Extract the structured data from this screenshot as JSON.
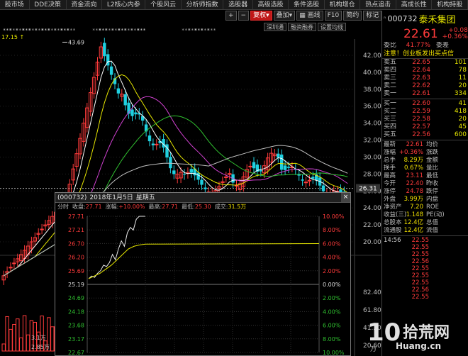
{
  "menu": [
    "股市场",
    "DDE决策",
    "资金流向",
    "L2核心内参",
    "个股风云",
    "分析师指数",
    "选股器",
    "高级选股",
    "条件选股",
    "机构增仓",
    "热点追击",
    "高成长性",
    "机构持股"
  ],
  "toolbar": {
    "plus": "+",
    "minus": "−",
    "restore": "复权",
    "overlay": "叠加",
    "lines": "画线",
    "f10": "F10",
    "flip": "简约",
    "marker": "标记"
  },
  "toolbar2": [
    "深圳通",
    "融资融券",
    "设置均线"
  ],
  "main": {
    "top_price_label": "17.15",
    "peak_label": "43.69",
    "axis_ticks": [
      "42.00",
      "40.00",
      "38.00",
      "36.00",
      "34.00",
      "32.00",
      "30.00",
      "28.00",
      "26.00",
      "24.00",
      "22.00",
      "20.00"
    ],
    "current_price_tag": "26.31",
    "vol_ticks": [
      "82.40",
      "61.80",
      "41.20",
      "20.60"
    ],
    "vol_unit": "万",
    "vol_left": [
      "3.1万",
      "2.85万"
    ]
  },
  "popup": {
    "title_code": "(000732)",
    "title_date": "2018年1月5日",
    "title_weekday": "星期五",
    "close": "×",
    "info": {
      "tab": "分时",
      "close_label": "收盘:",
      "close_value": "27.71",
      "chg_label": "涨幅:",
      "chg_value": "+10.00%",
      "high_label": "最高:",
      "high_value": "27.71",
      "low_label": "最低:",
      "low_value": "25.30",
      "amt_label": "成交:",
      "amt_value": "31.5万"
    },
    "left_ticks": [
      "27.71",
      "27.21",
      "26.70",
      "26.20",
      "25.69",
      "25.19",
      "24.69",
      "24.18",
      "23.68",
      "23.17",
      "22.67"
    ],
    "right_ticks": [
      "10.00%",
      "8.00%",
      "6.00%",
      "4.00%",
      "2.00%",
      "0.00%",
      "2.00%",
      "4.00%",
      "6.00%",
      "8.00%",
      "10.00%"
    ]
  },
  "stock": {
    "code": "000732",
    "name": "泰禾集团",
    "price": "22.61",
    "change": "+0.08",
    "change_pct": "+0.36%"
  },
  "ratio": {
    "k1": "委比",
    "v1": "41.77%",
    "k2": "委差",
    "v2": ""
  },
  "notice": "注意！创业板发出买点信",
  "sells": [
    {
      "k": "卖五",
      "v": "22.65",
      "q": "101"
    },
    {
      "k": "卖四",
      "v": "22.64",
      "q": "78"
    },
    {
      "k": "卖三",
      "v": "22.63",
      "q": "11"
    },
    {
      "k": "卖二",
      "v": "22.62",
      "q": "20"
    },
    {
      "k": "卖一",
      "v": "22.61",
      "q": "334"
    }
  ],
  "buys": [
    {
      "k": "买一",
      "v": "22.60",
      "q": "41"
    },
    {
      "k": "买二",
      "v": "22.59",
      "q": "418"
    },
    {
      "k": "买三",
      "v": "22.58",
      "q": "20"
    },
    {
      "k": "买四",
      "v": "22.57",
      "q": "45"
    },
    {
      "k": "买五",
      "v": "22.56",
      "q": "600"
    }
  ],
  "stats": [
    {
      "k1": "最新",
      "v1": "22.61",
      "k2": "均价",
      "v2": ""
    },
    {
      "k1": "涨幅",
      "v1": "+0.36%",
      "k2": "涨跌",
      "v2": ""
    },
    {
      "k1": "总手",
      "v1": "8.29万",
      "k2": "金额",
      "v2": ""
    },
    {
      "k1": "换手",
      "v1": "0.67%",
      "k2": "量比",
      "v2": ""
    },
    {
      "k1": "最高",
      "v1": "23.11",
      "k2": "最低",
      "v2": ""
    },
    {
      "k1": "今开",
      "v1": "22.40",
      "k2": "昨收",
      "v2": ""
    },
    {
      "k1": "涨停",
      "v1": "24.78",
      "k2": "跌停",
      "v2": ""
    },
    {
      "k1": "外盘",
      "v1": "3.99万",
      "k2": "内盘",
      "v2": ""
    },
    {
      "k1": "净资产",
      "v1": "7.20",
      "k2": "ROE",
      "v2": ""
    },
    {
      "k1": "收益(三)",
      "v1": "1.148",
      "k2": "PE(动)",
      "v2": ""
    },
    {
      "k1": "总股本",
      "v1": "12.4亿",
      "k2": "总值",
      "v2": ""
    },
    {
      "k1": "流通股",
      "v1": "12.4亿",
      "k2": "流值",
      "v2": ""
    }
  ],
  "ticks": [
    {
      "t": "14:56",
      "p": "22.55",
      "a": ""
    },
    {
      "t": "",
      "p": "22.55",
      "a": ""
    },
    {
      "t": "",
      "p": "22.55",
      "a": ""
    },
    {
      "t": "",
      "p": "22.56",
      "a": ""
    },
    {
      "t": "",
      "p": "22.55",
      "a": ""
    },
    {
      "t": "",
      "p": "22.55",
      "a": ""
    },
    {
      "t": "",
      "p": "22.55",
      "a": ""
    },
    {
      "t": "",
      "p": "22.56",
      "a": ""
    },
    {
      "t": "",
      "p": "22.55",
      "a": ""
    }
  ],
  "watermark": {
    "num": "10",
    "cn": "拾荒网",
    "url": "Huang.cn"
  },
  "colors": {
    "up": "#ff3b3b",
    "down": "#1fd0e0",
    "ma5": "#ffffff",
    "ma10": "#e6e600",
    "ma20": "#d040d0",
    "ma30": "#30c030",
    "ma60": "#c0c0c0"
  }
}
